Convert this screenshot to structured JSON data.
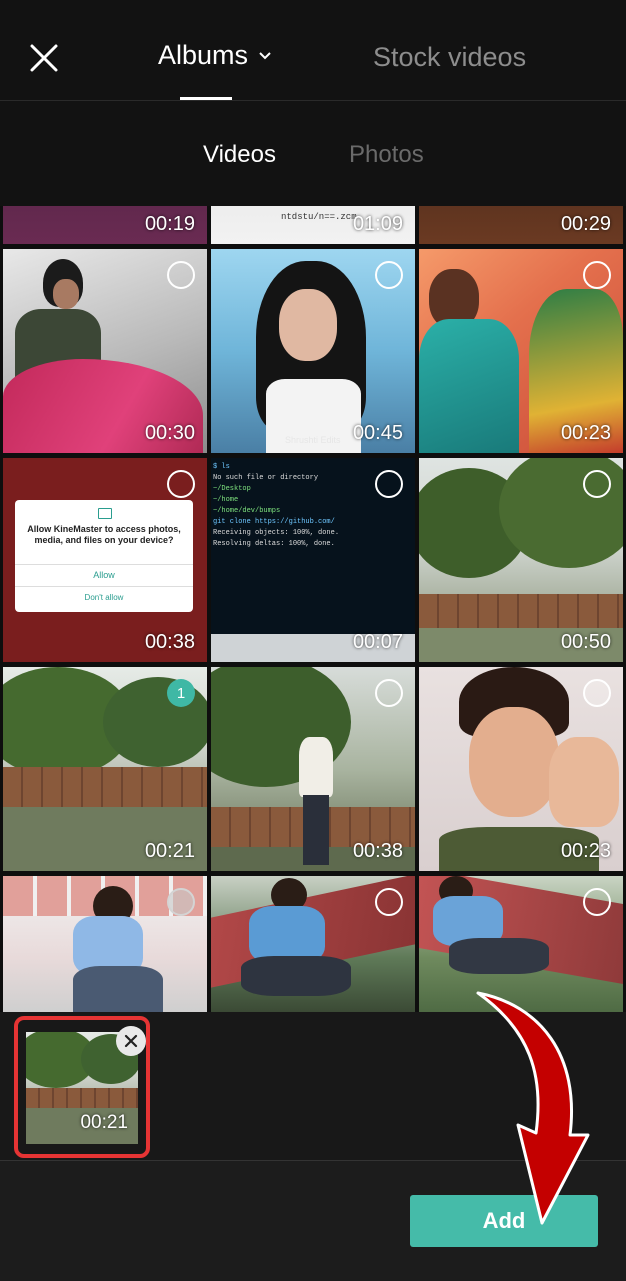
{
  "header": {
    "albums_label": "Albums",
    "stock_label": "Stock videos"
  },
  "subtabs": {
    "videos_label": "Videos",
    "photos_label": "Photos"
  },
  "grid": {
    "partial_row": [
      "00:19",
      "01:09",
      "00:29"
    ],
    "partial_row_text": "ntdstu/n==.zcm",
    "rows": [
      [
        "00:30",
        "00:45",
        "00:23"
      ],
      [
        "00:38",
        "00:07",
        "00:50"
      ],
      [
        "00:21",
        "00:38",
        "00:23"
      ]
    ],
    "selected_index_label": "1",
    "watermark": "Shrushti Edits"
  },
  "permission_dialog": {
    "text": "Allow KineMaster to access photos, media, and files on your device?",
    "allow": "Allow",
    "deny": "Don't allow"
  },
  "terminal_lines": [
    "$ ls",
    "No such file or directory",
    "~/Desktop",
    "~/home",
    "~/home/dev/bumps",
    "git clone https://github.com/",
    "Receiving objects: 100%, done.",
    "Resolving deltas: 100%, done."
  ],
  "tray": {
    "selected_duration": "00:21"
  },
  "footer": {
    "add_label": "Add"
  },
  "colors": {
    "accent": "#45bba9",
    "highlight": "#e63434",
    "arrow": "#c40000"
  }
}
